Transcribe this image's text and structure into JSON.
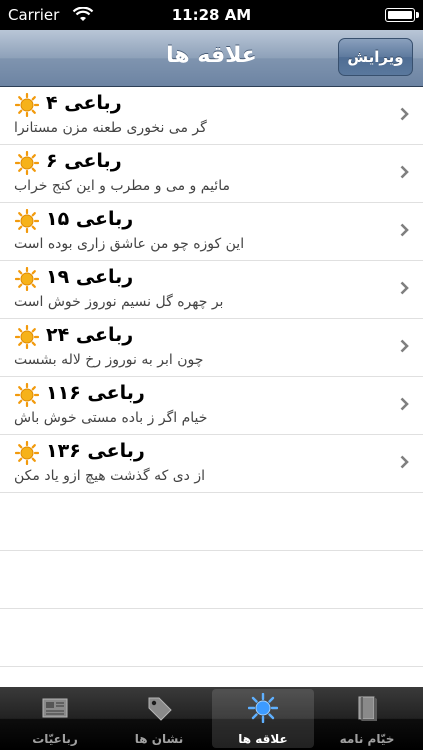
{
  "status_bar": {
    "carrier": "Carrier",
    "time": "11:28 AM"
  },
  "nav": {
    "title": "علاقه ها",
    "edit_label": "ویرایش"
  },
  "rows": [
    {
      "title": "رباعی ۴",
      "subtitle": "گر می نخوری طعنه مزن مستانرا"
    },
    {
      "title": "رباعی ۶",
      "subtitle": "مائیم و می و مطرب و این کنج خراب"
    },
    {
      "title": "رباعی ۱۵",
      "subtitle": "این کوزه چو من عاشق زاری بوده است"
    },
    {
      "title": "رباعی ۱۹",
      "subtitle": "بر چهره گل نسیم نوروز خوش است"
    },
    {
      "title": "رباعی ۲۴",
      "subtitle": "چون ابر به نوروز رخ لاله بشست"
    },
    {
      "title": "رباعی ۱۱۶",
      "subtitle": "خیام اگر ز باده مستی خوش باش"
    },
    {
      "title": "رباعی ۱۳۶",
      "subtitle": "از دی که گذشت هیچ ازو یاد مکن"
    }
  ],
  "tabs": [
    {
      "label": "رباعیّات",
      "icon": "newspaper-icon"
    },
    {
      "label": "نشان ها",
      "icon": "tag-icon"
    },
    {
      "label": "علاقه ها",
      "icon": "sun-icon",
      "selected": true
    },
    {
      "label": "خیّام نامه",
      "icon": "book-icon"
    }
  ],
  "colors": {
    "nav_top": "#b9c6d7",
    "nav_bottom": "#6d84a3",
    "sun": "#f6b21a",
    "tab_bar": "#111111"
  }
}
